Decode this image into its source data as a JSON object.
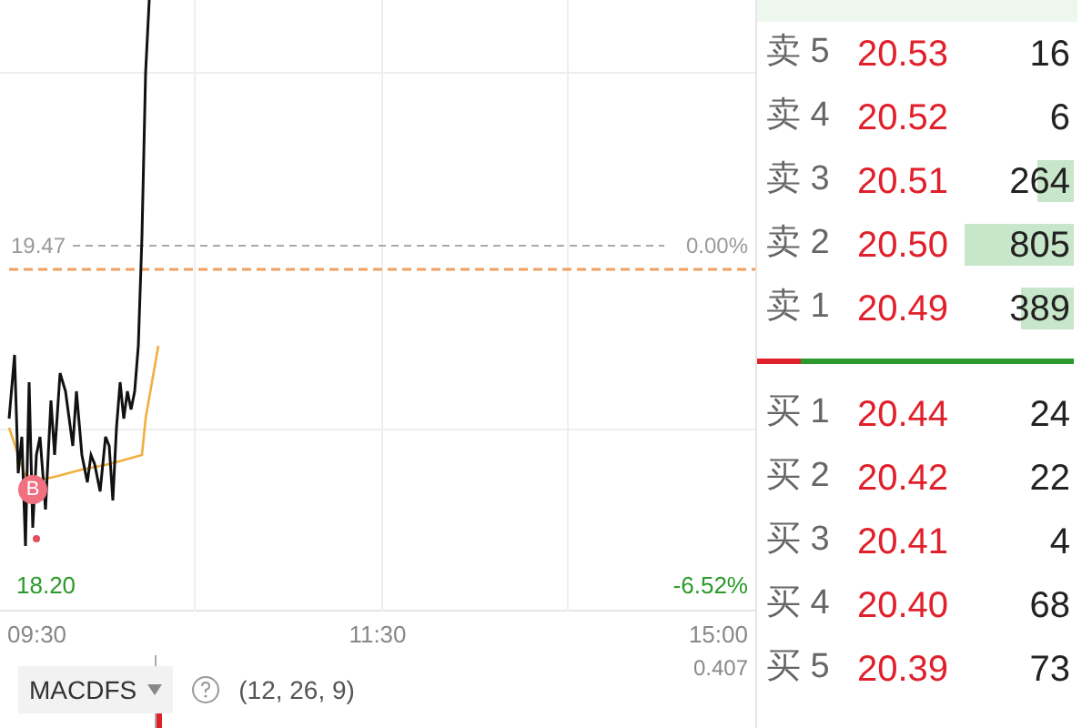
{
  "chart": {
    "ref_price": "19.47",
    "ref_pct": "0.00%",
    "low_price": "18.20",
    "low_pct": "-6.52%",
    "trade_marker": "B",
    "times": [
      "09:30",
      "11:30",
      "15:00"
    ]
  },
  "indicator": {
    "name": "MACDFS",
    "params": "(12, 26, 9)",
    "value": "0.407"
  },
  "order_book": {
    "asks": [
      {
        "label": "卖 5",
        "price": "20.53",
        "volume": "16",
        "volume_bar": false
      },
      {
        "label": "卖 4",
        "price": "20.52",
        "volume": "6",
        "volume_bar": false
      },
      {
        "label": "卖 3",
        "price": "20.51",
        "volume": "264",
        "volume_bar": true
      },
      {
        "label": "卖 2",
        "price": "20.50",
        "volume": "805",
        "volume_bar": true
      },
      {
        "label": "卖 1",
        "price": "20.49",
        "volume": "389",
        "volume_bar": true
      }
    ],
    "ratio_bar": {
      "level": 0.14
    },
    "bids": [
      {
        "label": "买 1",
        "price": "20.44",
        "volume": "24",
        "volume_bar": false
      },
      {
        "label": "买 2",
        "price": "20.42",
        "volume": "22",
        "volume_bar": false
      },
      {
        "label": "买 3",
        "price": "20.41",
        "volume": "4",
        "volume_bar": false
      },
      {
        "label": "买 4",
        "price": "20.40",
        "volume": "68",
        "volume_bar": false
      },
      {
        "label": "买 5",
        "price": "20.39",
        "volume": "73",
        "volume_bar": false
      }
    ]
  }
}
